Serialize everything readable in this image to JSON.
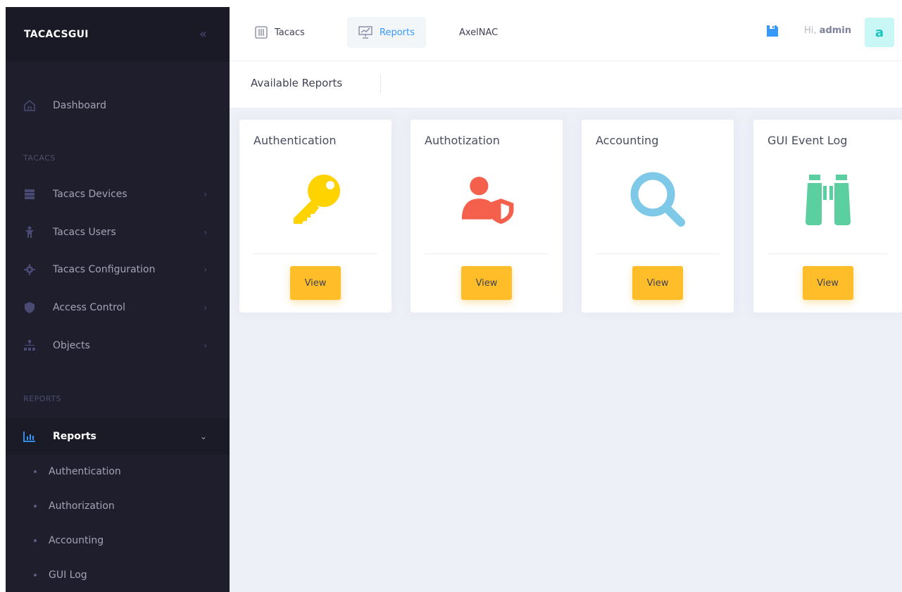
{
  "sidebar": {
    "brand": "TACACSGUI",
    "dashboard": "Dashboard",
    "section_tacacs": "TACACS",
    "items": [
      {
        "label": "Tacacs Devices"
      },
      {
        "label": "Tacacs Users"
      },
      {
        "label": "Tacacs Configuration"
      },
      {
        "label": "Access Control"
      },
      {
        "label": "Objects"
      }
    ],
    "section_reports": "REPORTS",
    "reports": "Reports",
    "sub_items": [
      {
        "label": "Authentication"
      },
      {
        "label": "Authorization"
      },
      {
        "label": "Accounting"
      },
      {
        "label": "GUI Log"
      }
    ]
  },
  "header": {
    "tabs": [
      {
        "label": "Tacacs"
      },
      {
        "label": "Reports"
      },
      {
        "label": "AxelNAC"
      }
    ],
    "greeting": "Hi,",
    "user": "admin",
    "avatar_letter": "a"
  },
  "subheader": {
    "title": "Available Reports"
  },
  "cards": [
    {
      "title": "Authentication",
      "button": "View",
      "icon": "key-icon",
      "color": "#ffd300"
    },
    {
      "title": "Authotization",
      "button": "View",
      "icon": "user-shield-icon",
      "color": "#f4604b"
    },
    {
      "title": "Accounting",
      "button": "View",
      "icon": "magnifier-icon",
      "color": "#7ec8e8"
    },
    {
      "title": "GUI Event Log",
      "button": "View",
      "icon": "binoculars-icon",
      "color": "#5bcfa0"
    }
  ],
  "colors": {
    "sidebar_bg": "#1e1e2d",
    "active_tab": "#3699ff",
    "button": "#ffbd29",
    "reports_icon": "#3699ff"
  }
}
